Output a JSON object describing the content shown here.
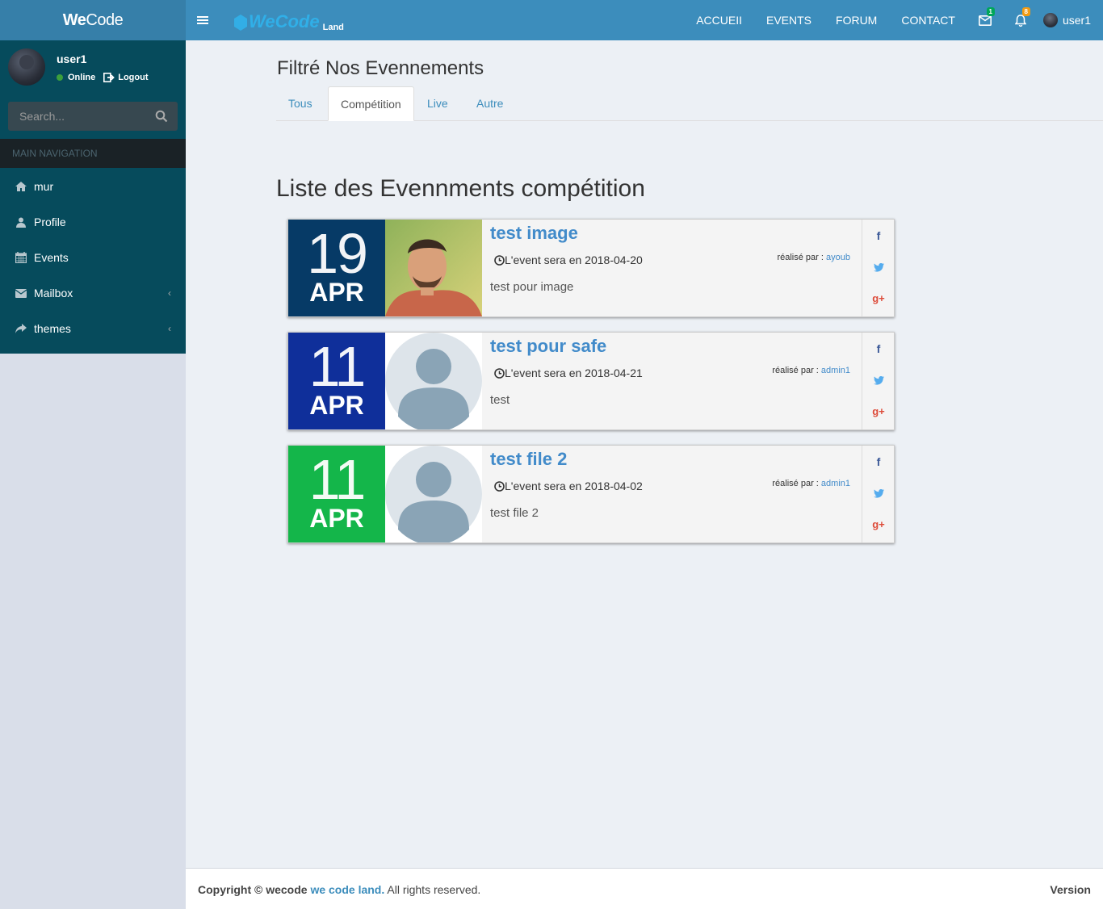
{
  "sidebar": {
    "logo_bold": "We",
    "logo_rest": "Code",
    "user": {
      "name": "user1",
      "status": "Online",
      "logout": "Logout"
    },
    "search": {
      "placeholder": "Search..."
    },
    "nav_header": "MAIN NAVIGATION",
    "items": [
      {
        "label": "mur",
        "icon": "home-icon"
      },
      {
        "label": "Profile",
        "icon": "user-icon"
      },
      {
        "label": "Events",
        "icon": "calendar-icon"
      },
      {
        "label": "Mailbox",
        "icon": "envelope-icon",
        "has_submenu": true
      },
      {
        "label": "themes",
        "icon": "share-icon",
        "has_submenu": true
      }
    ]
  },
  "topbar": {
    "brand": "WeCode",
    "brand_sub": "Land",
    "links": [
      "ACCUEII",
      "EVENTS",
      "FORUM",
      "CONTACT"
    ],
    "mail_badge": "1",
    "notif_badge": "8",
    "user_label": "user1",
    "colors": {
      "mail_badge": "#00a65a",
      "notif_badge": "#f39c12"
    }
  },
  "main": {
    "filter_title": "Filtré Nos Evennements",
    "tabs": [
      {
        "label": "Tous",
        "active": false
      },
      {
        "label": "Compétition",
        "active": true
      },
      {
        "label": "Live",
        "active": false
      },
      {
        "label": "Autre",
        "active": false
      }
    ],
    "list_title": "Liste des Evennments compétition",
    "events": [
      {
        "day": "19",
        "month": "APR",
        "color": "#063a66",
        "title": "test image",
        "date_text": "L'event sera en 2018-04-20",
        "by_label": "réalisé par :",
        "by_user": "ayoub",
        "desc": "test pour image",
        "photo": "portrait"
      },
      {
        "day": "11",
        "month": "APR",
        "color": "#0f2f9a",
        "title": "test pour safe",
        "date_text": "L'event sera en 2018-04-21",
        "by_label": "réalisé par :",
        "by_user": "admin1",
        "desc": "test",
        "photo": "placeholder"
      },
      {
        "day": "11",
        "month": "APR",
        "color": "#14b64a",
        "title": "test file 2",
        "date_text": "L'event sera en 2018-04-02",
        "by_label": "réalisé par :",
        "by_user": "admin1",
        "desc": "test file 2",
        "photo": "placeholder"
      }
    ]
  },
  "footer": {
    "copy_prefix": "Copyright © wecode",
    "copy_link": "we code land.",
    "copy_suffix": "All rights reserved.",
    "version": "Version"
  }
}
